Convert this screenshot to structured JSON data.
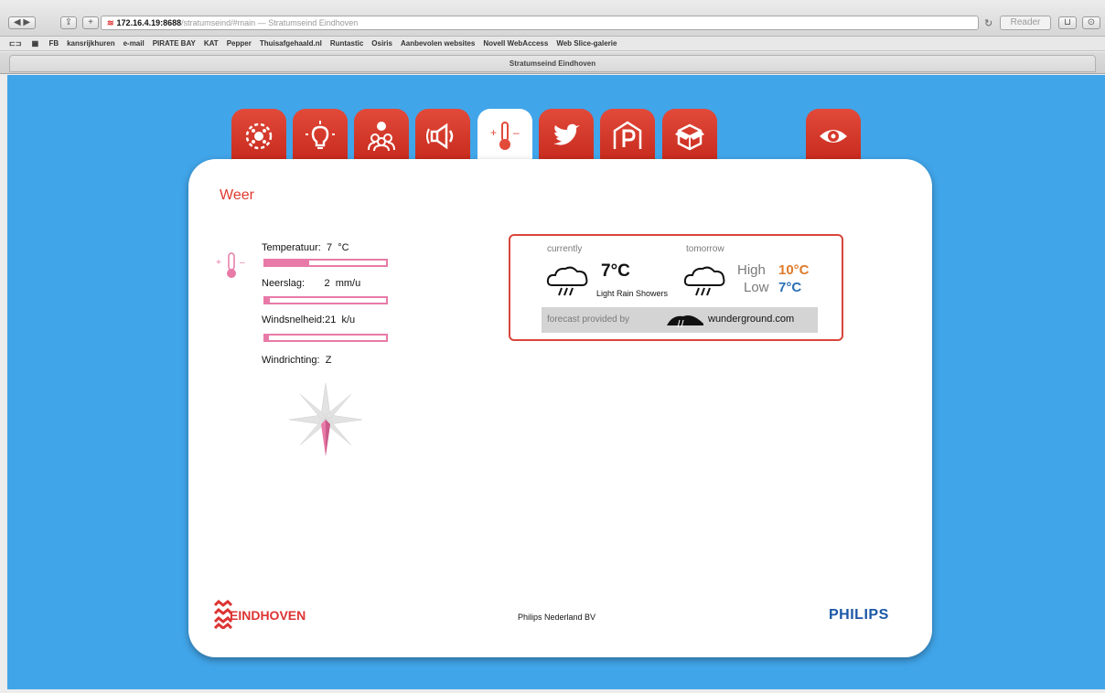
{
  "browser": {
    "url_host": "172.16.4.19:8688",
    "url_path": "/stratumseind/#main",
    "url_title": "— Stratumseind Eindhoven",
    "reader_label": "Reader",
    "tab_title": "Stratumseind Eindhoven",
    "bookmarks": [
      "FB",
      "kansrijkhuren",
      "e-mail",
      "PIRATE BAY",
      "KAT",
      "Pepper",
      "Thuisafgehaald.nl",
      "Runtastic",
      "Osiris",
      "Aanbevolen websites",
      "Novell WebAccess",
      "Web Slice-galerie"
    ]
  },
  "nav": {
    "tabs": [
      {
        "icon": "sensor-icon",
        "active": false
      },
      {
        "icon": "lightbulb-icon",
        "active": false
      },
      {
        "icon": "people-location-icon",
        "active": false
      },
      {
        "icon": "sound-icon",
        "active": false
      },
      {
        "icon": "thermometer-icon",
        "active": true
      },
      {
        "icon": "twitter-bird-icon",
        "active": false
      },
      {
        "icon": "parking-icon",
        "active": false
      },
      {
        "icon": "box-icon",
        "active": false
      },
      {
        "icon": "eye-icon",
        "active": false
      }
    ]
  },
  "weather": {
    "title": "Weer",
    "temperature_label": "Temperatuur:",
    "temperature_value": "7",
    "temperature_unit": "°C",
    "temperature_level": 0.36,
    "precip_label": "Neerslag:",
    "precip_value": "2",
    "precip_unit": "mm/u",
    "precip_level": 0.04,
    "wind_label": "Windsnelheid:",
    "wind_value": "21",
    "wind_unit": "k/u",
    "wind_level": 0.03,
    "direction_label": "Windrichting:",
    "direction_value": "Z"
  },
  "forecast": {
    "currently_label": "currently",
    "tomorrow_label": "tomorrow",
    "current_temp": "7°C",
    "current_condition": "Light Rain Showers",
    "high_label": "High",
    "high_value": "10°C",
    "low_label": "Low",
    "low_value": "7°C",
    "provided_by": "forecast provided by",
    "provider": "wunderground.com",
    "colors": {
      "border": "#d9453a",
      "high": "#e07a2a",
      "low": "#2a6fb5"
    }
  },
  "footer": {
    "city": "EINDHOVEN",
    "company": "Philips Nederland BV",
    "brand": "PHILIPS"
  },
  "colors": {
    "page_bg": "#41a5e9",
    "tab_red": "#d63a2c",
    "accent_pink": "#e87aa8"
  }
}
